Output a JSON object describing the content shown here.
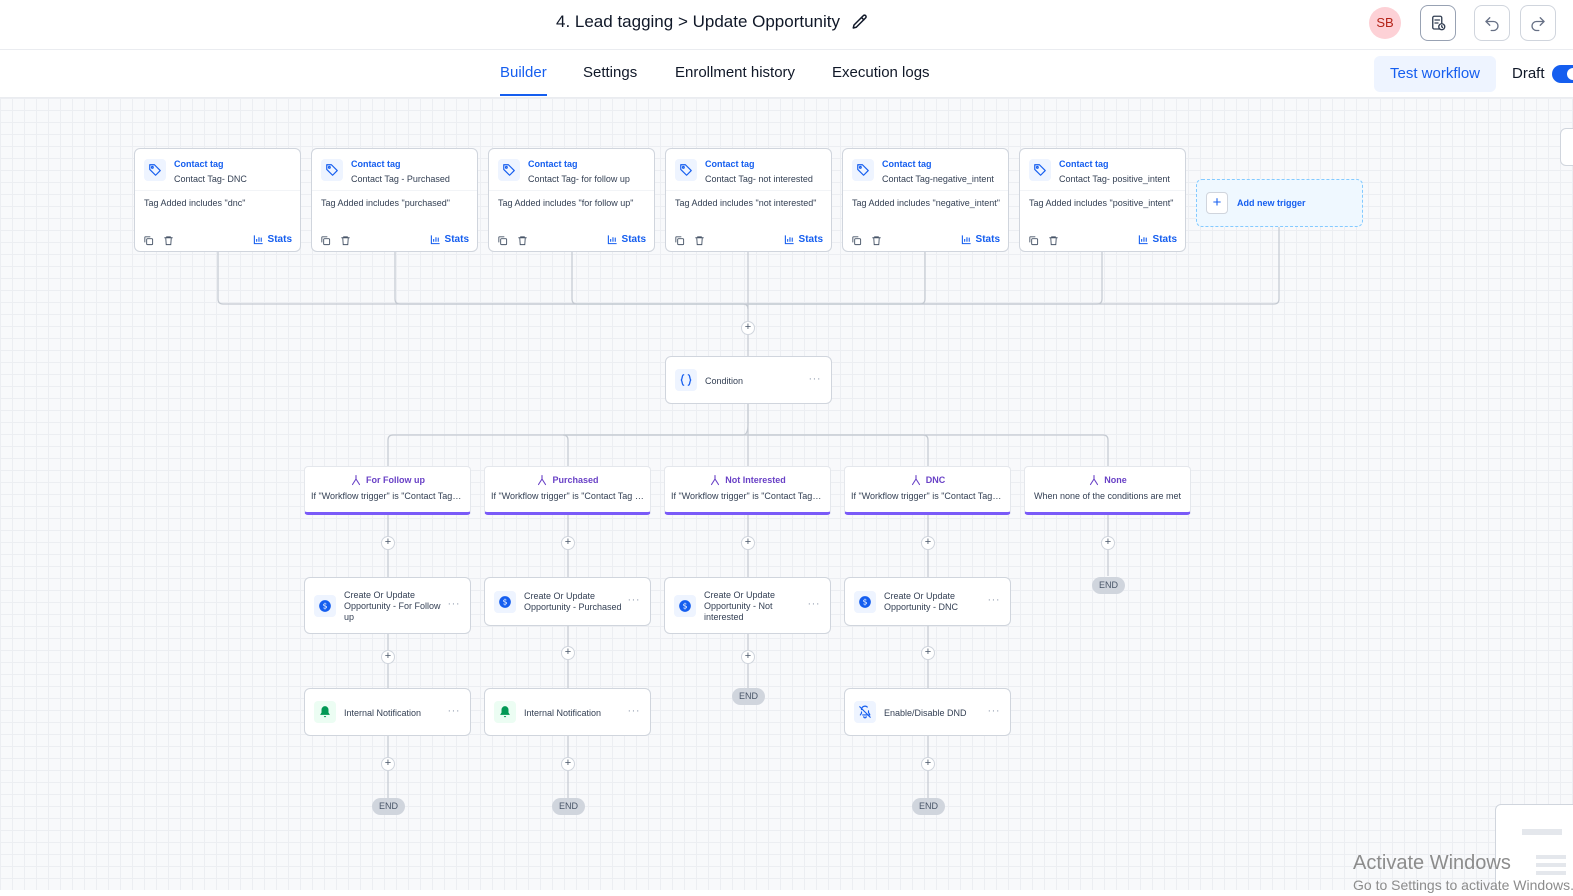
{
  "header": {
    "workflow_title": "4. Lead tagging > Update Opportunity",
    "avatar_initials": "SB",
    "avatar_bg": "#fdd1d6"
  },
  "tabs": [
    {
      "label": "Builder",
      "active": true
    },
    {
      "label": "Settings",
      "active": false
    },
    {
      "label": "Enrollment history",
      "active": false
    },
    {
      "label": "Execution logs",
      "active": false
    }
  ],
  "actions": {
    "test_workflow": "Test workflow",
    "draft_label": "Draft"
  },
  "colors": {
    "accent": "#155eef",
    "branch_accent": "#7a5af8",
    "notification_green": "#039855"
  },
  "triggers": [
    {
      "type": "Contact tag",
      "name": "Contact Tag- DNC",
      "filter": "Tag Added includes \"dnc\"",
      "stats_label": "Stats"
    },
    {
      "type": "Contact tag",
      "name": "Contact Tag - Purchased",
      "filter": "Tag Added includes \"purchased\"",
      "stats_label": "Stats"
    },
    {
      "type": "Contact tag",
      "name": "Contact Tag- for follow up",
      "filter": "Tag Added includes \"for follow up\"",
      "stats_label": "Stats"
    },
    {
      "type": "Contact tag",
      "name": "Contact Tag- not interested",
      "filter": "Tag Added includes \"not interested\"",
      "stats_label": "Stats"
    },
    {
      "type": "Contact tag",
      "name": "Contact Tag-negative_intent",
      "filter": "Tag Added includes \"negative_intent\"",
      "stats_label": "Stats"
    },
    {
      "type": "Contact tag",
      "name": "Contact Tag- positive_intent",
      "filter": "Tag Added includes \"positive_intent\"",
      "stats_label": "Stats"
    }
  ],
  "add_trigger_label": "Add new trigger",
  "condition": {
    "label": "Condition",
    "icon": "braces-icon"
  },
  "branches": [
    {
      "title": "For Follow up",
      "subtitle": "If \"Workflow trigger\" is \"Contact Tag- for follow up\""
    },
    {
      "title": "Purchased",
      "subtitle": "If \"Workflow trigger\" is \"Contact Tag - Purchased\""
    },
    {
      "title": "Not Interested",
      "subtitle": "If \"Workflow trigger\" is \"Contact Tag- not interested\""
    },
    {
      "title": "DNC",
      "subtitle": "If \"Workflow trigger\" is \"Contact Tag- DNC\""
    },
    {
      "title": "None",
      "subtitle": "When none of the conditions are met"
    }
  ],
  "opportunity_actions": [
    {
      "label": "Create Or Update Opportunity - For Follow up",
      "icon": "dollar-icon"
    },
    {
      "label": "Create Or Update Opportunity - Purchased",
      "icon": "dollar-icon"
    },
    {
      "label": "Create Or Update Opportunity - Not interested",
      "icon": "dollar-icon"
    },
    {
      "label": "Create Or Update Opportunity - DNC",
      "icon": "dollar-icon"
    }
  ],
  "second_actions": [
    {
      "label": "Internal Notification",
      "icon": "bell-icon"
    },
    {
      "label": "Internal Notification",
      "icon": "bell-icon"
    },
    {
      "label": "Enable/Disable DND",
      "icon": "bell-off-icon"
    }
  ],
  "end_label": "END",
  "node_menu_glyph": "···",
  "plus_glyph": "+",
  "watermark": {
    "line1": "Activate Windows",
    "line2": "Go to Settings to activate Windows."
  }
}
